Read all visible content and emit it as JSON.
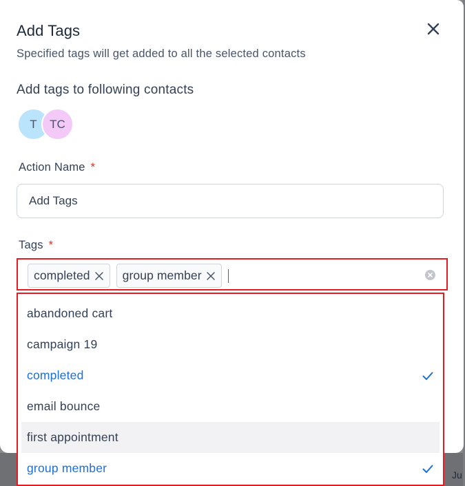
{
  "modal": {
    "title": "Add Tags",
    "subtitle": "Specified tags will get added to all the selected contacts",
    "contacts_heading": "Add tags to following contacts",
    "avatars": [
      "T",
      "TC"
    ]
  },
  "form": {
    "action_name_label": "Action Name",
    "required_mark": "*",
    "action_name_value": "Add Tags",
    "tags_label": "Tags",
    "selected_tags": [
      "completed",
      "group member"
    ]
  },
  "dropdown": {
    "options": [
      {
        "label": "abandoned cart",
        "selected": false
      },
      {
        "label": "campaign 19",
        "selected": false
      },
      {
        "label": "completed",
        "selected": true
      },
      {
        "label": "email bounce",
        "selected": false
      },
      {
        "label": "first appointment",
        "selected": false,
        "hovered": true
      },
      {
        "label": "group member",
        "selected": true
      }
    ]
  },
  "background": {
    "snippet_text": "Ju"
  },
  "colors": {
    "accent": "#1d6fd6",
    "highlight_border": "#e31b23",
    "required": "#d92d20"
  }
}
